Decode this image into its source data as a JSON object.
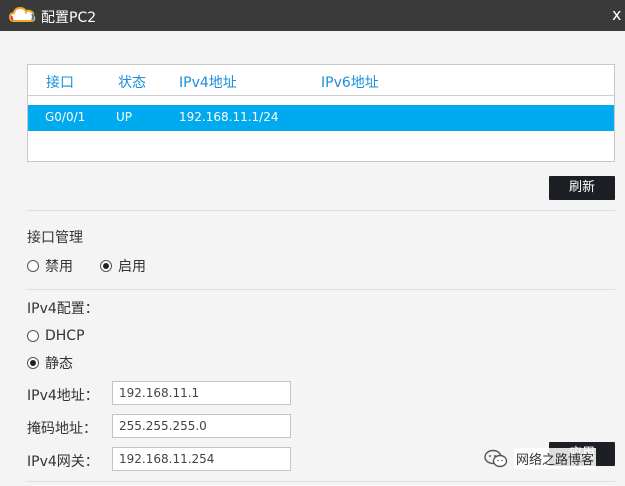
{
  "window": {
    "title": "配置PC2",
    "close_symbol": "x",
    "icon": "cloud-icon"
  },
  "interface_table": {
    "headers": [
      "接口",
      "状态",
      "IPv4地址",
      "IPv6地址"
    ],
    "rows": [
      {
        "interface": "G0/0/1",
        "status": "UP",
        "ipv4": "192.168.11.1/24",
        "ipv6": "",
        "selected": true
      }
    ]
  },
  "refresh_button": "刷新",
  "interface_management": {
    "label": "接口管理",
    "options": [
      "禁用",
      "启用"
    ],
    "selected": "启用"
  },
  "ipv4_config": {
    "label": "IPv4配置：",
    "options": [
      "DHCP",
      "静态"
    ],
    "selected": "静态",
    "fields": {
      "address_label": "IPv4地址：",
      "address_value": "192.168.11.1",
      "mask_label": "掩码地址：",
      "mask_value": "255.255.255.0",
      "gateway_label": "IPv4网关：",
      "gateway_value": "192.168.11.254"
    }
  },
  "apply_button": "应用",
  "watermark": {
    "text": "网络之路博客",
    "icon": "wechat-icon"
  },
  "colors": {
    "titlebar": "#3a3a3a",
    "header_text": "#1a8fd8",
    "selected_row": "#00aaee",
    "button": "#1c1f23"
  }
}
